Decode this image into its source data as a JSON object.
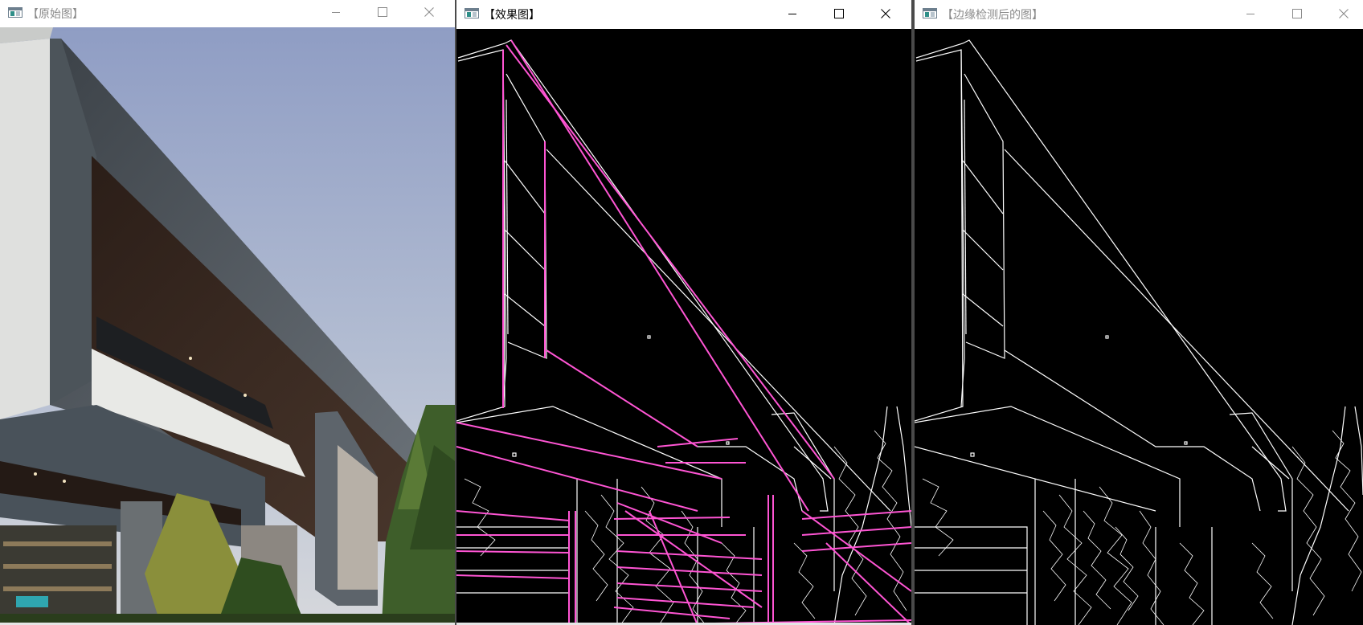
{
  "windows": [
    {
      "title": "【原始图】"
    },
    {
      "title": "【效果图】"
    },
    {
      "title": "【边缘检测后的图】"
    }
  ],
  "controls": {
    "minimize": "minimize-icon",
    "maximize": "maximize-icon",
    "close": "close-icon"
  },
  "colors": {
    "hough_lines": "#ff55d4",
    "edges": "#ffffff",
    "sky": "#a9b6cf",
    "background": "#000000"
  }
}
